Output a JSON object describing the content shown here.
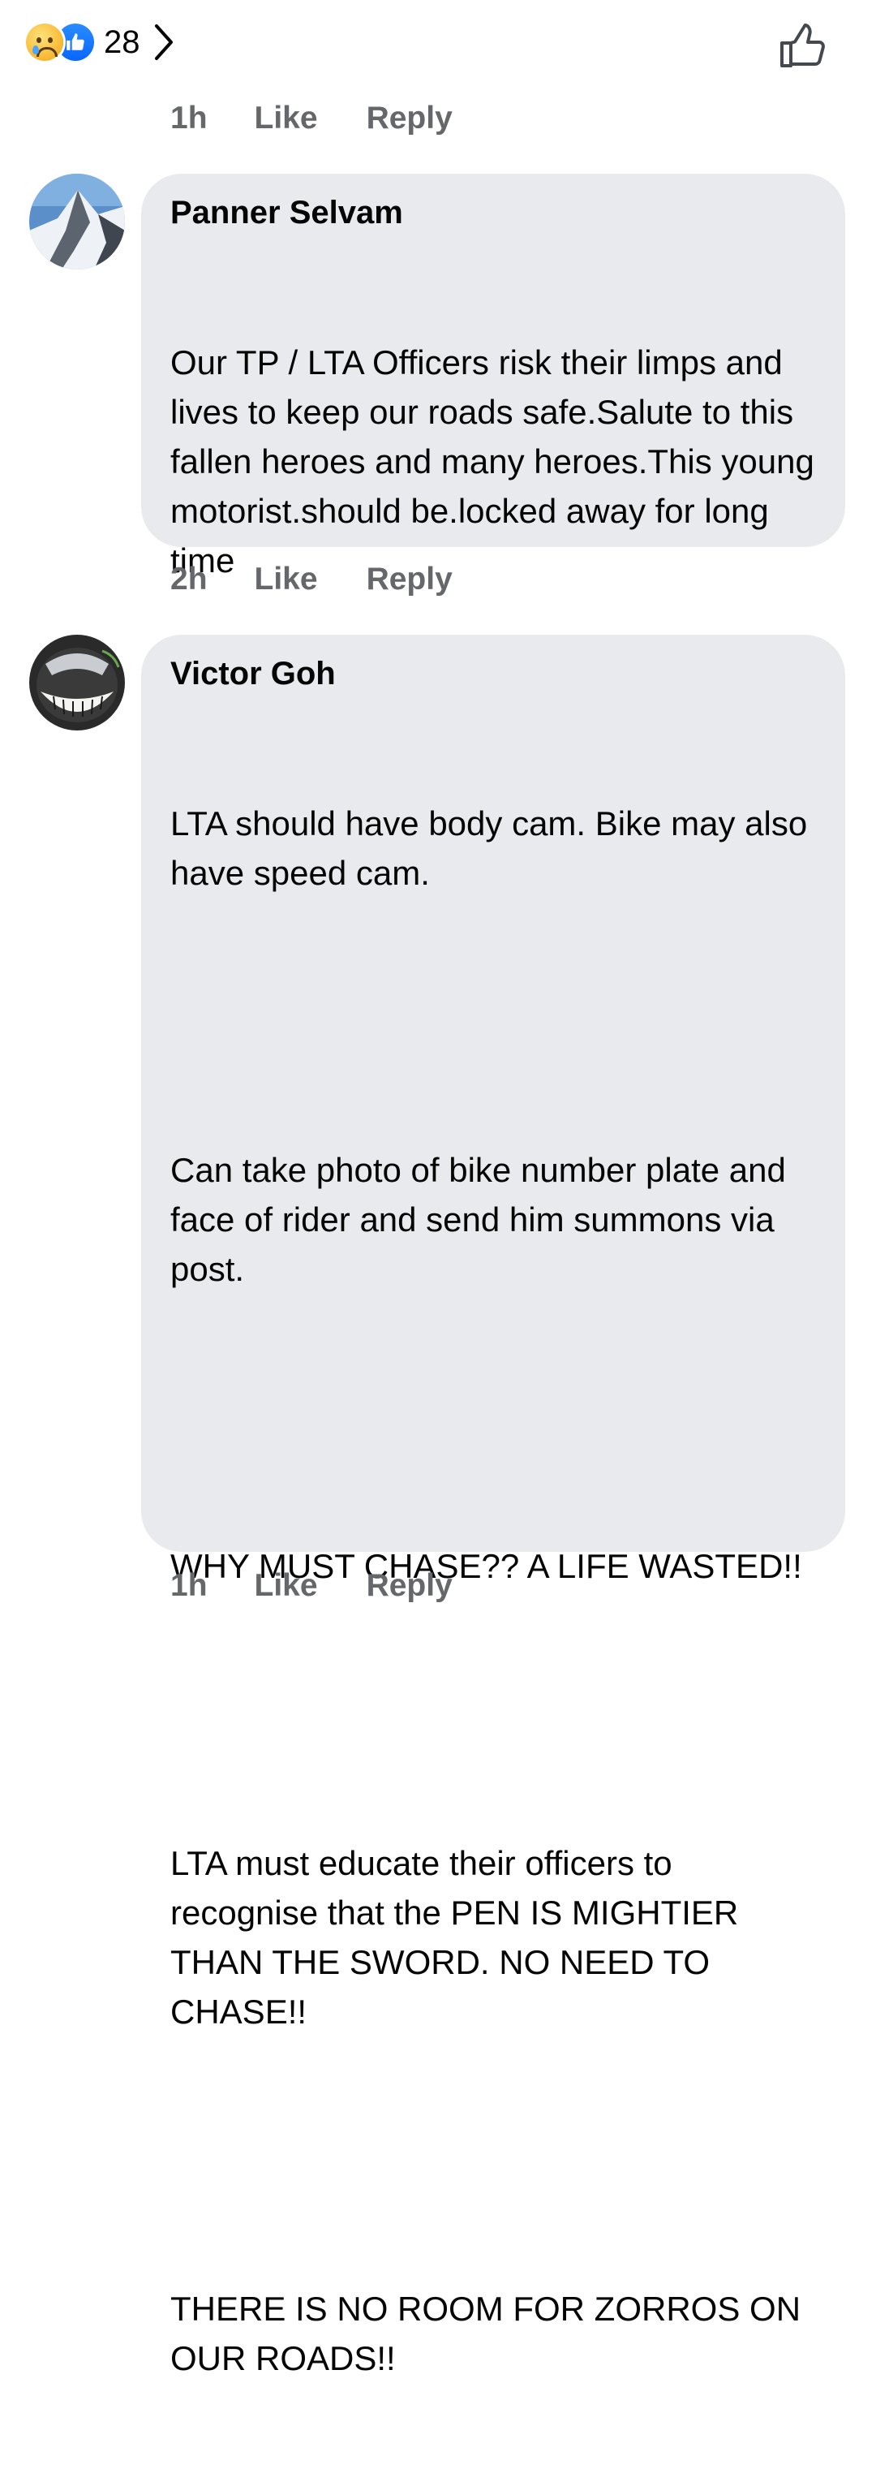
{
  "reactions": {
    "count": "28",
    "icons": [
      "sad-reaction-icon",
      "like-reaction-icon"
    ]
  },
  "top_actions": {
    "time": "1h",
    "like": "Like",
    "reply": "Reply"
  },
  "comments": [
    {
      "author": "Panner Selvam",
      "avatar": "mountain-snow-avatar",
      "paragraphs": [
        "Our TP / LTA Officers risk their limps and lives to keep our roads safe.Salute to this fallen heroes and many heroes.This young motorist.should be.locked away for long time"
      ],
      "time": "2h",
      "like": "Like",
      "reply": "Reply"
    },
    {
      "author": "Victor Goh",
      "avatar": "grinning-face-avatar",
      "paragraphs": [
        "LTA should have body cam. Bike may also have speed cam.",
        "Can take photo of bike number plate and face of rider and send him summons via post.",
        "WHY MUST CHASE?? A LIFE WASTED!!",
        "LTA must educate their officers to recognise that the PEN IS MIGHTIER THAN THE SWORD. NO NEED TO CHASE!!",
        "THERE IS NO ROOM FOR ZORROS ON OUR ROADS!!"
      ],
      "time": "1h",
      "like": "Like",
      "reply": "Reply"
    }
  ]
}
